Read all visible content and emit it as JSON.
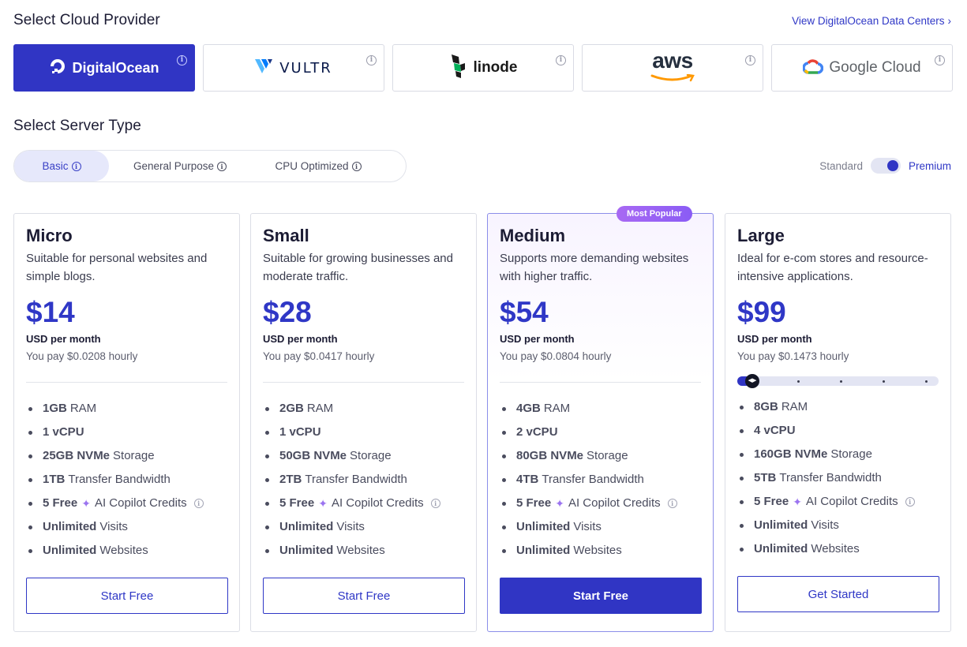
{
  "provider_section": {
    "title": "Select Cloud Provider",
    "data_centers_link": "View DigitalOcean Data Centers",
    "providers": [
      {
        "name": "DigitalOcean",
        "icon": "digitalocean-logo",
        "selected": true
      },
      {
        "name": "VULTR",
        "icon": "vultr-logo",
        "selected": false
      },
      {
        "name": "linode",
        "icon": "linode-logo",
        "selected": false
      },
      {
        "name": "aws",
        "icon": "aws-logo",
        "selected": false
      },
      {
        "name": "Google Cloud",
        "icon": "google-cloud-logo",
        "selected": false
      }
    ]
  },
  "server_section": {
    "title": "Select Server Type",
    "tabs": [
      {
        "label": "Basic",
        "active": true
      },
      {
        "label": "General Purpose",
        "active": false
      },
      {
        "label": "CPU Optimized",
        "active": false
      }
    ],
    "toggle": {
      "left_label": "Standard",
      "right_label": "Premium",
      "value": "Premium"
    }
  },
  "plans": [
    {
      "name": "Micro",
      "description": "Suitable for personal websites and simple blogs.",
      "price": "$14",
      "period": "USD per month",
      "hourly": "You pay $0.0208 hourly",
      "features": [
        {
          "bold": "1GB",
          "text": "RAM"
        },
        {
          "bold": "1 vCPU",
          "text": ""
        },
        {
          "bold": "25GB NVMe",
          "text": "Storage"
        },
        {
          "bold": "1TB",
          "text": "Transfer Bandwidth"
        },
        {
          "bold": "5 Free",
          "text": "AI Copilot Credits"
        },
        {
          "bold": "Unlimited",
          "text": "Visits"
        },
        {
          "bold": "Unlimited",
          "text": "Websites"
        }
      ],
      "cta": "Start Free"
    },
    {
      "name": "Small",
      "description": "Suitable for growing businesses and moderate traffic.",
      "price": "$28",
      "period": "USD per month",
      "hourly": "You pay $0.0417 hourly",
      "features": [
        {
          "bold": "2GB",
          "text": "RAM"
        },
        {
          "bold": "1 vCPU",
          "text": ""
        },
        {
          "bold": "50GB NVMe",
          "text": "Storage"
        },
        {
          "bold": "2TB",
          "text": "Transfer Bandwidth"
        },
        {
          "bold": "5 Free",
          "text": "AI Copilot Credits"
        },
        {
          "bold": "Unlimited",
          "text": "Visits"
        },
        {
          "bold": "Unlimited",
          "text": "Websites"
        }
      ],
      "cta": "Start Free"
    },
    {
      "name": "Medium",
      "badge": "Most Popular",
      "description": "Supports more demanding websites with higher traffic.",
      "price": "$54",
      "period": "USD per month",
      "hourly": "You pay $0.0804 hourly",
      "features": [
        {
          "bold": "4GB",
          "text": "RAM"
        },
        {
          "bold": "2 vCPU",
          "text": ""
        },
        {
          "bold": "80GB NVMe",
          "text": "Storage"
        },
        {
          "bold": "4TB",
          "text": "Transfer Bandwidth"
        },
        {
          "bold": "5 Free",
          "text": "AI Copilot Credits"
        },
        {
          "bold": "Unlimited",
          "text": "Visits"
        },
        {
          "bold": "Unlimited",
          "text": "Websites"
        }
      ],
      "cta": "Start Free"
    },
    {
      "name": "Large",
      "description": "Ideal for e-com stores and resource-intensive applications.",
      "price": "$99",
      "period": "USD per month",
      "hourly": "You pay $0.1473 hourly",
      "size_slider": {
        "steps": 5,
        "position": 1
      },
      "features": [
        {
          "bold": "8GB",
          "text": "RAM"
        },
        {
          "bold": "4 vCPU",
          "text": ""
        },
        {
          "bold": "160GB NVMe",
          "text": "Storage"
        },
        {
          "bold": "5TB",
          "text": "Transfer Bandwidth"
        },
        {
          "bold": "5 Free",
          "text": "AI Copilot Credits"
        },
        {
          "bold": "Unlimited",
          "text": "Visits"
        },
        {
          "bold": "Unlimited",
          "text": "Websites"
        }
      ],
      "cta": "Get Started"
    }
  ],
  "colors": {
    "accent": "#3035c4",
    "badge": "#9b6cf4",
    "border": "#dcdee6"
  }
}
